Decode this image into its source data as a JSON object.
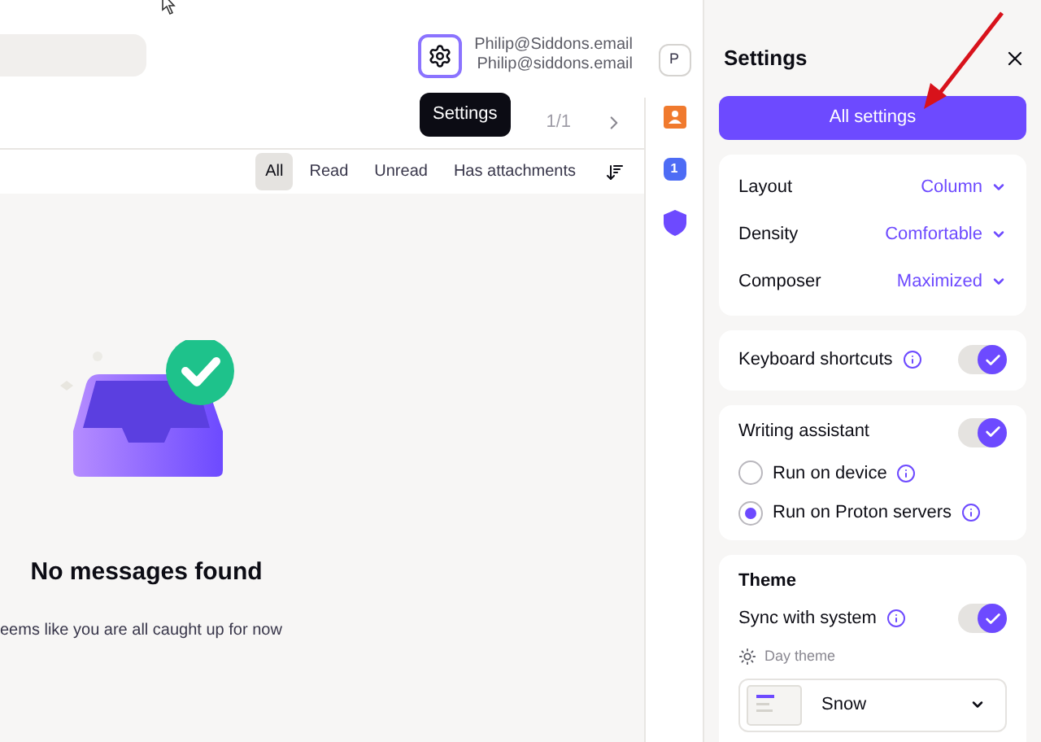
{
  "header": {
    "settings_tooltip": "Settings",
    "account": {
      "name": "Philip@Siddons.email",
      "email": "Philip@siddons.email",
      "initial": "P"
    }
  },
  "toolbar": {
    "pagination": "1/1"
  },
  "filters": [
    {
      "label": "All",
      "selected": true
    },
    {
      "label": "Read",
      "selected": false
    },
    {
      "label": "Unread",
      "selected": false
    },
    {
      "label": "Has attachments",
      "selected": false
    }
  ],
  "empty_state": {
    "title": "No messages found",
    "subtitle": "eems like you are all caught up for now"
  },
  "rail": {
    "calendar_day": "1"
  },
  "settings": {
    "title": "Settings",
    "all_settings_button": "All settings",
    "selects": [
      {
        "label": "Layout",
        "value": "Column"
      },
      {
        "label": "Density",
        "value": "Comfortable"
      },
      {
        "label": "Composer",
        "value": "Maximized"
      }
    ],
    "keyboard_shortcuts": {
      "label": "Keyboard shortcuts",
      "on": true
    },
    "writing_assistant": {
      "label": "Writing assistant",
      "on": true,
      "options": [
        {
          "label": "Run on device",
          "selected": false
        },
        {
          "label": "Run on Proton servers",
          "selected": true
        }
      ]
    },
    "theme": {
      "title": "Theme",
      "sync": {
        "label": "Sync with system",
        "on": true
      },
      "day_theme_label": "Day theme",
      "day_theme_value": "Snow"
    }
  }
}
